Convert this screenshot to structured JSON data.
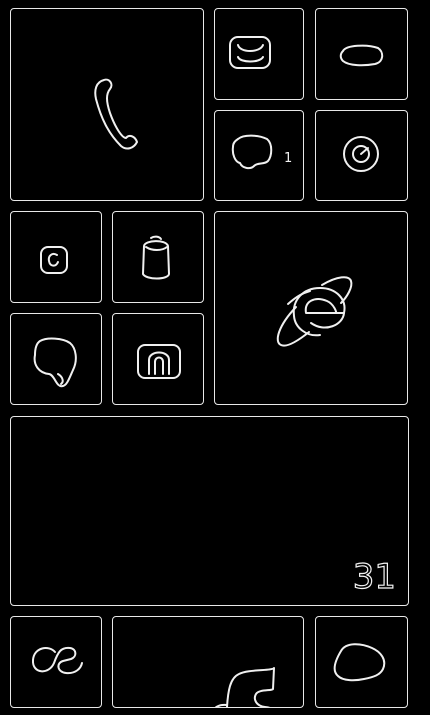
{
  "start_screen": {
    "tiles": {
      "phone": {
        "icon": "phone-icon"
      },
      "messaging": {
        "icon": "message-icon"
      },
      "mail": {
        "icon": "mail-icon"
      },
      "people": {
        "icon": "people-icon",
        "count": "1"
      },
      "clock": {
        "icon": "clock-icon"
      },
      "small_a": {
        "icon": "app-icon"
      },
      "small_b": {
        "icon": "store-icon"
      },
      "internet_explorer": {
        "icon": "internet-explorer-icon"
      },
      "maps": {
        "icon": "maps-icon"
      },
      "camera": {
        "icon": "camera-icon"
      },
      "calendar": {
        "icon": "calendar-icon",
        "day": "31"
      },
      "lastfm": {
        "icon": "lastfm-icon"
      },
      "music": {
        "icon": "music-icon"
      },
      "skype": {
        "icon": "skype-icon"
      }
    },
    "colors": {
      "background": "#000000",
      "tile_outline": "#e8e8e8"
    }
  }
}
